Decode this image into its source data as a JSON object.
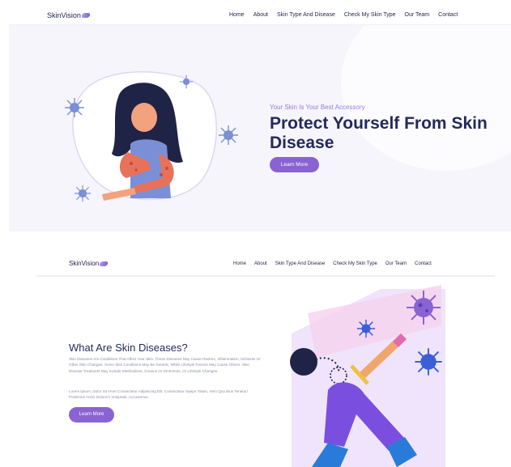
{
  "brand": {
    "name": "SkinVision"
  },
  "nav": {
    "links": [
      "Home",
      "About",
      "Skin Type And Disease",
      "Check My Skin Type",
      "Our Team",
      "Contact"
    ]
  },
  "hero": {
    "tagline": "Your Skin Is Your Best Accessory",
    "title": "Protect Yourself From Skin Disease",
    "button_label": "Learn More"
  },
  "section": {
    "title": "What Are Skin Diseases?",
    "paragraph1": "Skin Diseases Are Conditions That Affect Your Skin. These Diseases May Cause Rashes, Inflammation, Itchiness Or Other Skin Changes. Some Skin Conditions May Be Genetic, While Lifestyle Factors May Cause Others. Skin Disease Treatment May Include Medications, Creams Or Ointments, Or Lifestyle Changes.",
    "paragraph2": "Lorem Ipsum, Dolor Sit Amet Consectetur Adipisicing Elit. Consectetur Saepe Totam, Vero Quo Eius Tenetur! Possimus Animi Dolorem Voluptate. Accusamus.",
    "button_label": "Learn More"
  },
  "colors": {
    "accent": "#8a63d2",
    "heading": "#242a5a",
    "tagline": "#9a7bd6",
    "virus": "#7b8fd6",
    "virus_dark": "#5b3fb8"
  },
  "icons": [
    "virus-icon",
    "logo-icon"
  ]
}
